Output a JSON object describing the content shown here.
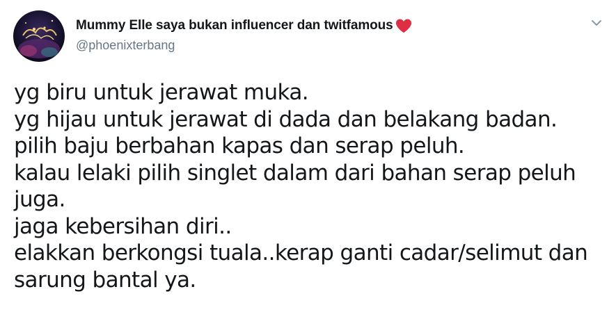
{
  "tweet": {
    "author": {
      "display_name": "Mummy Elle saya bukan influencer dan twitfamous",
      "emoji": "❤",
      "handle": "@phoenixterbang"
    },
    "menu_icon": "chevron-down-icon",
    "text_lines": [
      "yg biru untuk jerawat muka.",
      "yg hijau untuk jerawat di dada dan belakang badan.",
      "pilih baju berbahan kapas dan serap peluh.",
      "kalau lelaki pilih singlet dalam dari bahan serap peluh",
      "juga.",
      "jaga kebersihan diri..",
      "elakkan berkongsi tuala..kerap ganti cadar/selimut dan",
      "sarung bantal ya."
    ]
  },
  "colors": {
    "text": "#14171a",
    "secondary": "#657786",
    "heart": "#e0245e"
  }
}
